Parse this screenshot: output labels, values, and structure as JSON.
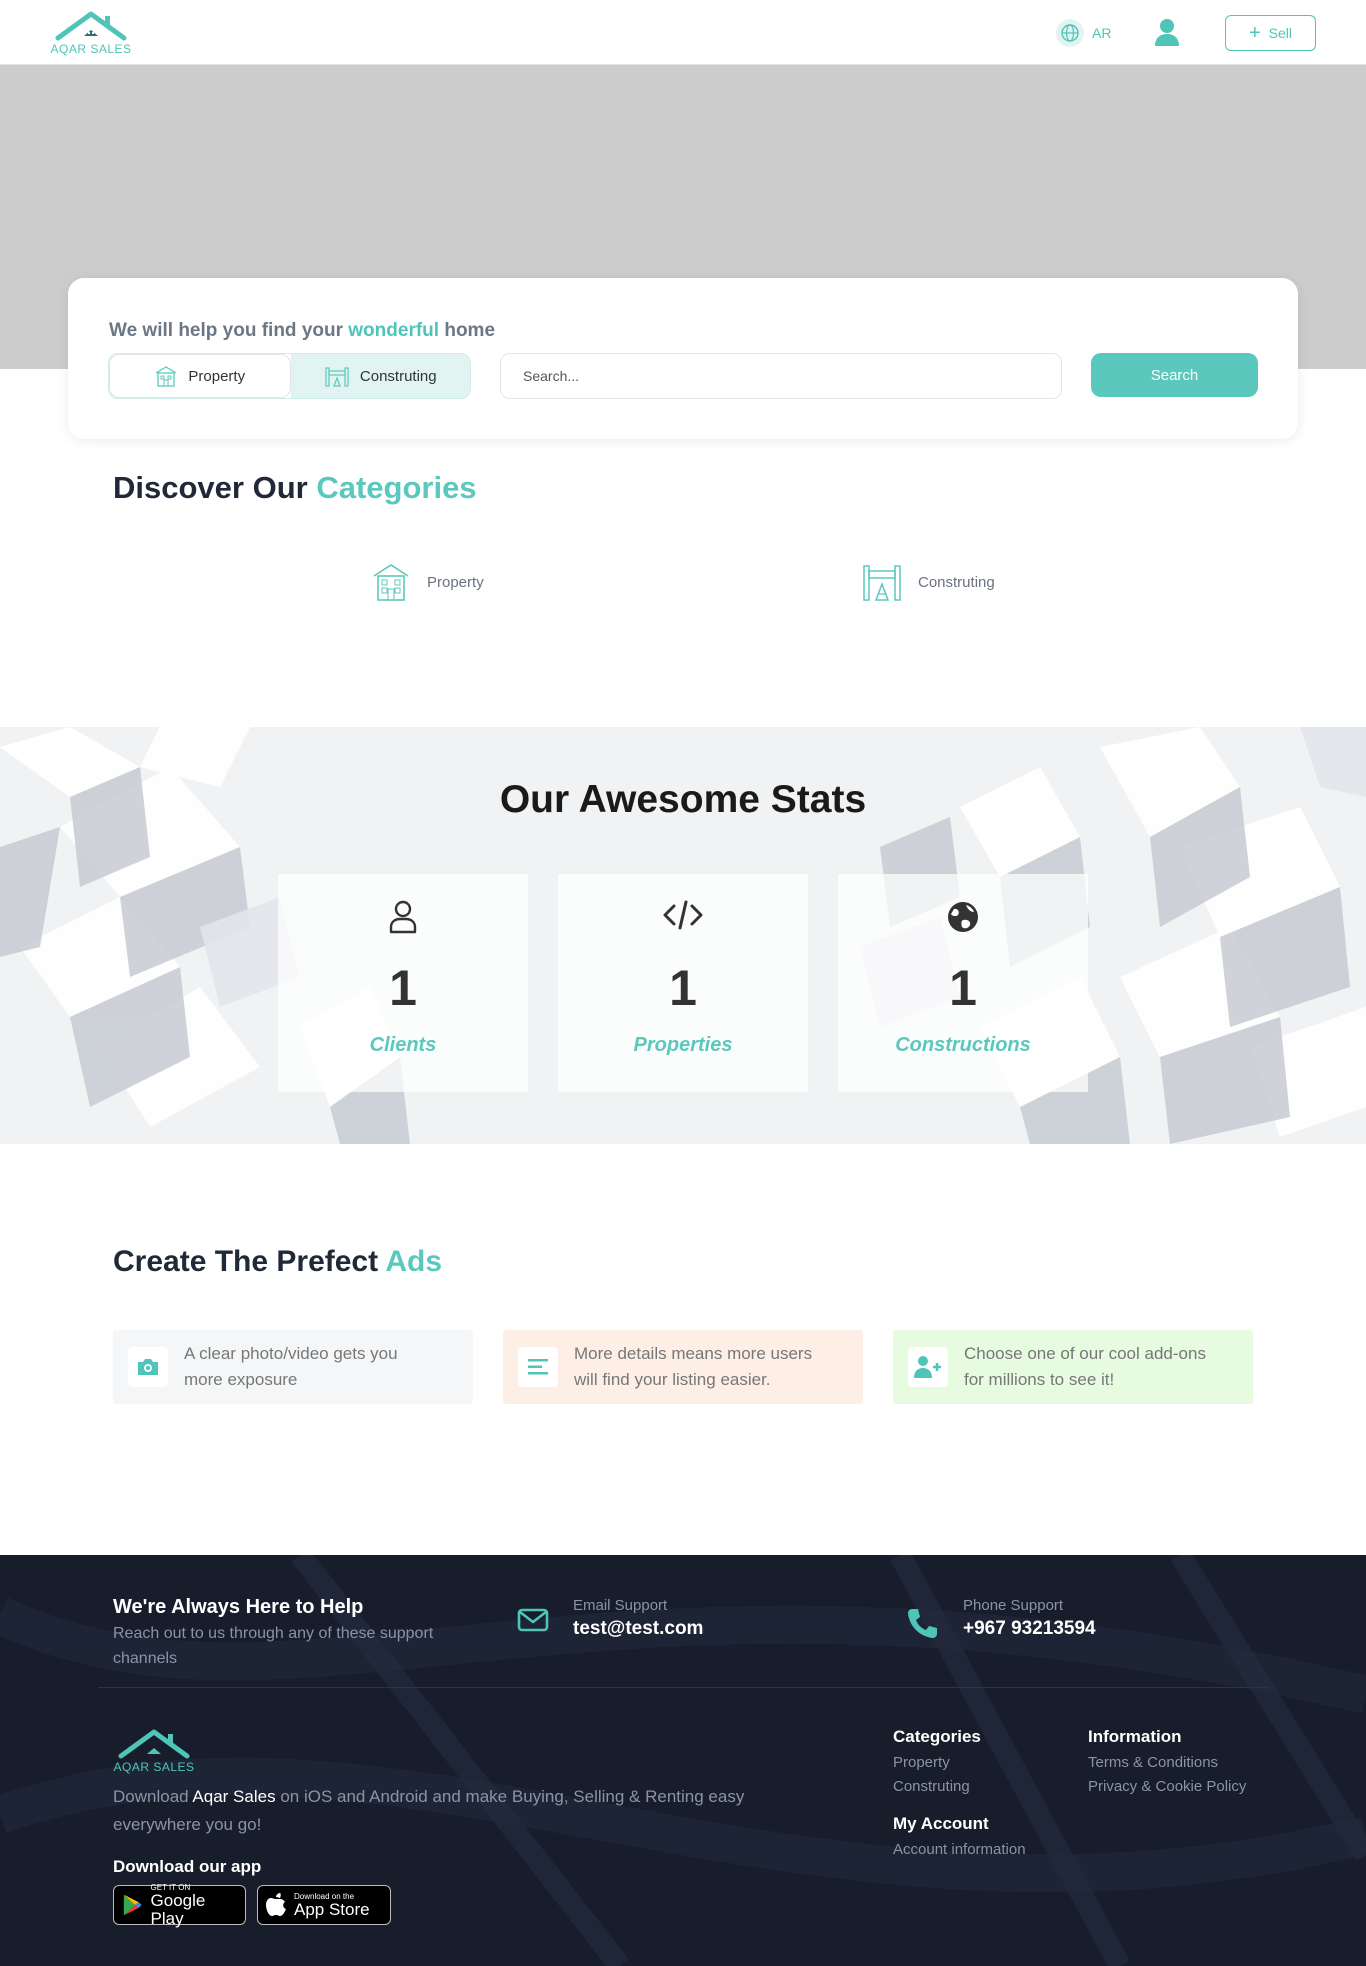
{
  "header": {
    "brand": "AQAR SALES",
    "lang_label": "AR",
    "sell_label": "Sell"
  },
  "hero": {
    "headline_pre": "We will help you find your",
    "headline_accent": "wonderful",
    "headline_post": "home",
    "toggle_options": [
      "Property",
      "Construting"
    ],
    "search_placeholder": "Search...",
    "search_button": "Search"
  },
  "categories": {
    "title_pre": "Discover Our",
    "title_accent": "Categories",
    "items": [
      "Property",
      "Construting"
    ]
  },
  "stats": {
    "title": "Our Awesome Stats",
    "items": [
      {
        "icon": "user-icon",
        "value": "1",
        "label": "Clients"
      },
      {
        "icon": "code-icon",
        "value": "1",
        "label": "Properties"
      },
      {
        "icon": "globe-icon",
        "value": "1",
        "label": "Constructions"
      }
    ]
  },
  "ads": {
    "title_pre": "Create The Prefect",
    "title_accent": "Ads",
    "tips": [
      {
        "icon": "camera-icon",
        "line1": "A clear photo/video gets you",
        "line2": "more exposure",
        "bg": "#f4f6f8"
      },
      {
        "icon": "list-icon",
        "line1": "More details means more users",
        "line2": "will find your listing easier.",
        "bg": "#fdeee6"
      },
      {
        "icon": "add-user-icon",
        "line1": "Choose one of our cool add-ons",
        "line2": "for millions to see it!",
        "bg": "#e6fbe0"
      }
    ]
  },
  "footer": {
    "help_title": "We're Always Here to Help",
    "help_sub": "Reach out to us through any of these support channels",
    "email_label": "Email Support",
    "email_value": "test@test.com",
    "phone_label": "Phone Support",
    "phone_value": "+967 93213594",
    "brand": "AQAR SALES",
    "download_pre": "Download",
    "download_brand": "Aqar Sales",
    "download_post": "on iOS and Android and make Buying, Selling & Renting easy everywhere you go!",
    "download_title": "Download our app",
    "google_small": "GET IT ON",
    "google_big": "Google Play",
    "apple_small": "Download on the",
    "apple_big": "App Store",
    "categories_head": "Categories",
    "categories_links": [
      "Property",
      "Construting"
    ],
    "account_head": "My Account",
    "account_links": [
      "Account information"
    ],
    "info_head": "Information",
    "info_links": [
      "Terms & Conditions",
      "Privacy & Cookie Policy"
    ]
  },
  "colors": {
    "accent": "#5bc8bd",
    "footer_bg": "#171d2b",
    "hero_bg": "#cccccc"
  }
}
